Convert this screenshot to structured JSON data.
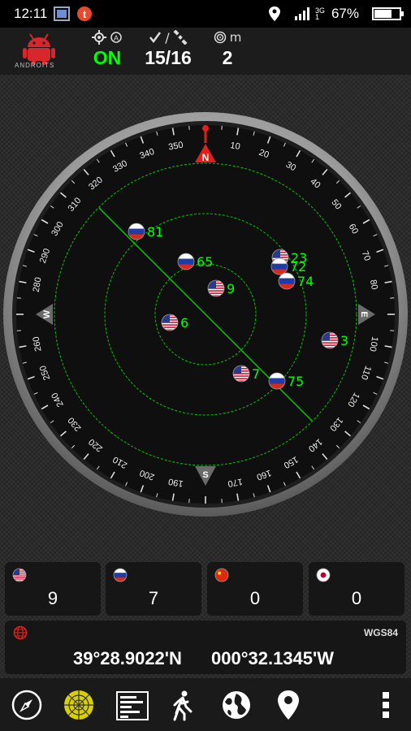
{
  "status_bar": {
    "time": "12:11",
    "network": "3G",
    "network_sub": "1",
    "battery": "67%"
  },
  "header": {
    "logo_text": "ANDROITS",
    "gps_state": "ON",
    "sats_used": "15",
    "sats_separator": "/",
    "sats_visible": "16",
    "accuracy_unit": "m",
    "accuracy": "2"
  },
  "compass": {
    "north": "N",
    "east": "E",
    "south": "S",
    "west": "W",
    "heading_labels": [
      "10",
      "20",
      "30",
      "40",
      "50",
      "60",
      "70",
      "80",
      "100",
      "110",
      "120",
      "130",
      "140",
      "150",
      "160",
      "170",
      "190",
      "200",
      "210",
      "220",
      "230",
      "240",
      "250",
      "260",
      "280",
      "290",
      "300",
      "310",
      "320",
      "330",
      "340",
      "350"
    ]
  },
  "satellites": [
    {
      "id": "81",
      "flag": "ru"
    },
    {
      "id": "65",
      "flag": "ru"
    },
    {
      "id": "23",
      "flag": "us"
    },
    {
      "id": "72",
      "flag": "ru"
    },
    {
      "id": "74",
      "flag": "ru"
    },
    {
      "id": "9",
      "flag": "us"
    },
    {
      "id": "6",
      "flag": "us"
    },
    {
      "id": "3",
      "flag": "us"
    },
    {
      "id": "7",
      "flag": "us"
    },
    {
      "id": "75",
      "flag": "ru"
    }
  ],
  "constellations": [
    {
      "flag": "us",
      "count": "9"
    },
    {
      "flag": "ru",
      "count": "7"
    },
    {
      "flag": "cn",
      "count": "0"
    },
    {
      "flag": "jp",
      "count": "0"
    }
  ],
  "position": {
    "datum": "WGS84",
    "latitude": "39°28.9022'N",
    "longitude": "000°32.1345'W"
  },
  "nav": [
    "compass-icon",
    "radar-icon",
    "signal-bars-icon",
    "walking-icon",
    "globe-icon",
    "location-pin-icon",
    "more-vert-icon"
  ],
  "colors": {
    "accent_green": "#00ff00",
    "north_red": "#e0201a"
  }
}
